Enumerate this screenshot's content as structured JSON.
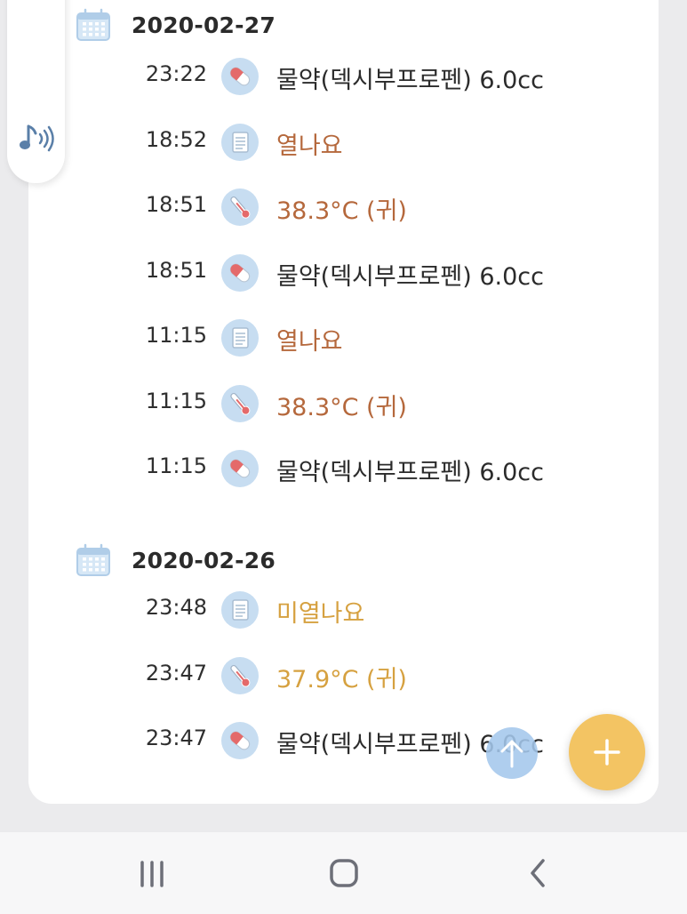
{
  "colors": {
    "background": "#ebebed",
    "card": "#ffffff",
    "icon_circle": "#c7ddf1",
    "text_dark": "#2b2b2b",
    "text_rust": "#b5683c",
    "text_amber": "#d6a140",
    "fab": "#f3c463",
    "scroll_top_button": "#a4c7ec"
  },
  "side_panel": {
    "icon": "music-note-sound-icon"
  },
  "groups": [
    {
      "date": "2020-02-27",
      "icon": "calendar-icon",
      "entries": [
        {
          "time": "23:22",
          "icon": "pill-icon",
          "label": "물약(덱시부프로펜) 6.0cc",
          "tone": "dark"
        },
        {
          "time": "18:52",
          "icon": "memo-icon",
          "label": "열나요",
          "tone": "rust"
        },
        {
          "time": "18:51",
          "icon": "thermometer-icon",
          "label": "38.3°C (귀)",
          "tone": "rust"
        },
        {
          "time": "18:51",
          "icon": "pill-icon",
          "label": "물약(덱시부프로펜) 6.0cc",
          "tone": "dark"
        },
        {
          "time": "11:15",
          "icon": "memo-icon",
          "label": "열나요",
          "tone": "rust"
        },
        {
          "time": "11:15",
          "icon": "thermometer-icon",
          "label": "38.3°C (귀)",
          "tone": "rust"
        },
        {
          "time": "11:15",
          "icon": "pill-icon",
          "label": "물약(덱시부프로펜) 6.0cc",
          "tone": "dark"
        }
      ]
    },
    {
      "date": "2020-02-26",
      "icon": "calendar-icon",
      "entries": [
        {
          "time": "23:48",
          "icon": "memo-icon",
          "label": "미열나요",
          "tone": "amber"
        },
        {
          "time": "23:47",
          "icon": "thermometer-icon",
          "label": "37.9°C (귀)",
          "tone": "amber"
        },
        {
          "time": "23:47",
          "icon": "pill-icon",
          "label": "물약(덱시부프로펜) 6.0cc",
          "tone": "dark"
        }
      ]
    }
  ],
  "buttons": {
    "scroll_top": {
      "icon": "arrow-up-icon"
    },
    "add": {
      "icon": "plus-icon"
    }
  },
  "navbar": [
    {
      "name": "recent-apps",
      "icon": "recent-apps-icon"
    },
    {
      "name": "home",
      "icon": "home-icon"
    },
    {
      "name": "back",
      "icon": "back-icon"
    }
  ]
}
